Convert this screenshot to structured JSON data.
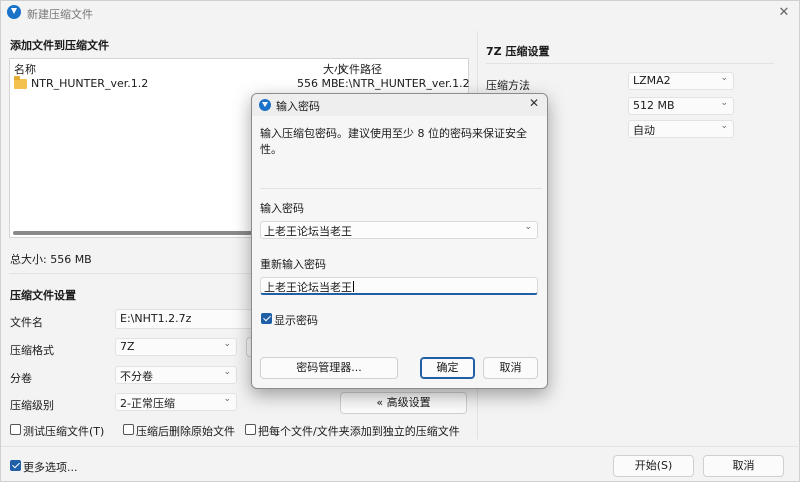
{
  "window": {
    "title": "新建压缩文件"
  },
  "add_section": {
    "title": "添加文件到压缩文件",
    "columns": {
      "name": "名称",
      "size": "大小",
      "path": "文件路径"
    },
    "rows": [
      {
        "name": "NTR_HUNTER_ver.1.2",
        "size": "556 MB",
        "path": "E:\\NTR_HUNTER_ver.1.2"
      }
    ],
    "total_size": "总大小: 556 MB"
  },
  "settings": {
    "title": "压缩文件设置",
    "filename_label": "文件名",
    "filename_value": "E:\\NHT1.2.7z",
    "format_label": "压缩格式",
    "format_value": "7Z",
    "split_label": "分卷",
    "split_value": "不分卷",
    "level_label": "压缩级别",
    "level_value": "2-正常压缩",
    "advanced_button": "« 高级设置",
    "test_archive": "测试压缩文件(T)",
    "delete_after": "压缩后删除原始文件",
    "separate_archives": "把每个文件/文件夹添加到独立的压缩文件"
  },
  "right_panel": {
    "title": "7Z 压缩设置",
    "method_label": "压缩方法",
    "method_value": "LZMA2",
    "dict_value": "512 MB",
    "word_value": "自动"
  },
  "footer": {
    "more_options": "更多选项...",
    "start_button": "开始(S)",
    "cancel_button": "取消"
  },
  "dialog": {
    "title": "输入密码",
    "description": "输入压缩包密码。建议使用至少 8 位的密码来保证安全性。",
    "password_label": "输入密码",
    "password_value": "上老王论坛当老王",
    "repeat_label": "重新输入密码",
    "repeat_value": "上老王论坛当老王",
    "show_password": "显示密码",
    "manager_button": "密码管理器...",
    "ok_button": "确定",
    "cancel_button": "取消"
  }
}
